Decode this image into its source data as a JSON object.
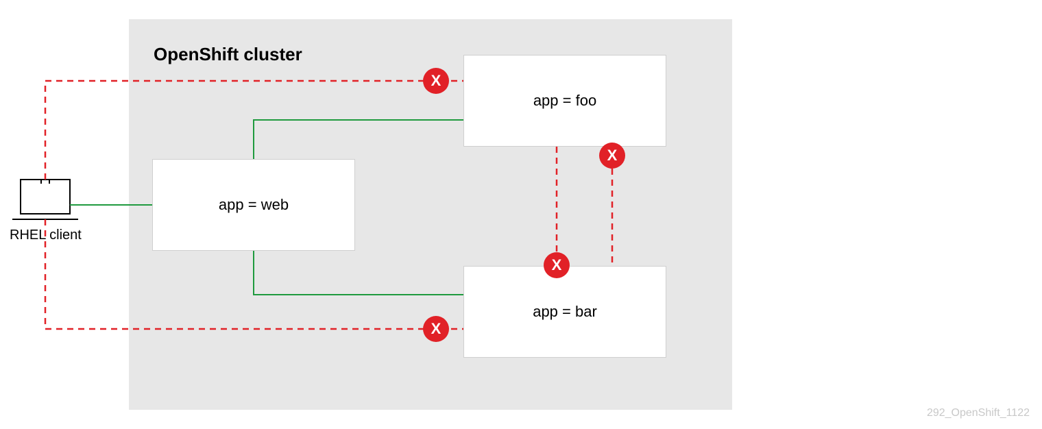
{
  "cluster": {
    "title": "OpenShift cluster"
  },
  "client": {
    "label": "RHEL client"
  },
  "nodes": {
    "web": {
      "label": "app = web"
    },
    "foo": {
      "label": "app = foo"
    },
    "bar": {
      "label": "app = bar"
    }
  },
  "badges": {
    "deny1": "X",
    "deny2": "X",
    "deny3": "X",
    "deny4": "X"
  },
  "footer": {
    "id": "292_OpenShift_1122"
  },
  "colors": {
    "allow": "#1f9a3e",
    "deny": "#e12127",
    "cluster_bg": "#e7e7e7",
    "node_border": "#cfcfcf"
  }
}
